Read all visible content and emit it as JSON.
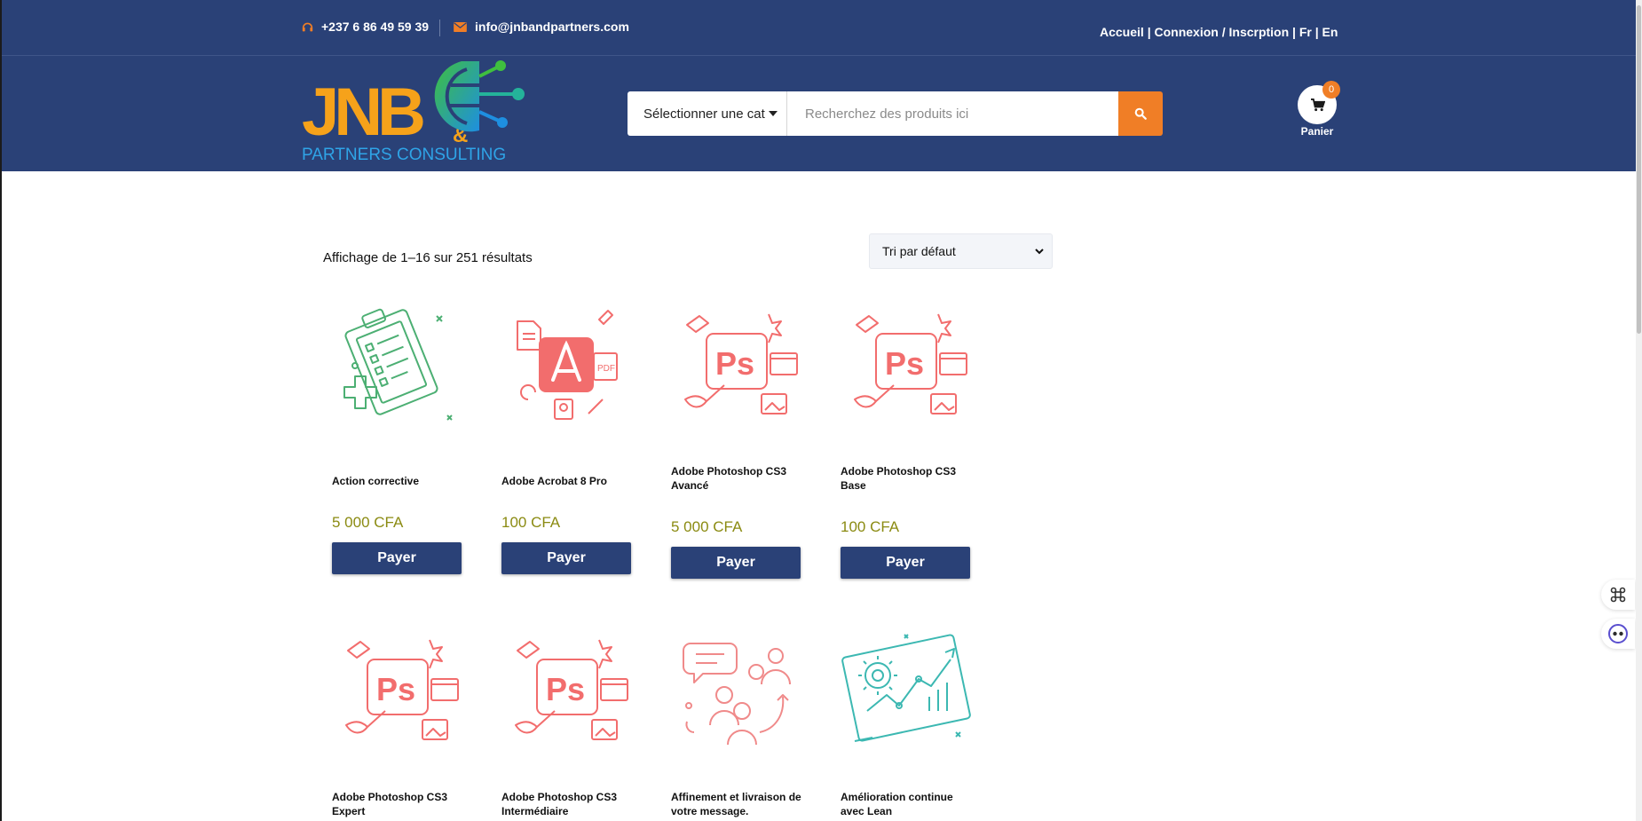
{
  "topbar": {
    "phone": "+237 6 86 49 59 39",
    "email": "info@jnbandpartners.com",
    "links": "Accueil | Connexion / Inscrption | Fr | En"
  },
  "logo": {
    "primary": "JNB",
    "ampersand": "&",
    "secondary": "PARTNERS CONSULTING"
  },
  "search": {
    "category_selected": "Sélectionner une cat",
    "placeholder": "Recherchez des produits ici"
  },
  "cart": {
    "count": "0",
    "label": "Panier"
  },
  "listing": {
    "result_count": "Affichage de 1–16 sur 251 résultats",
    "sort_selected": "Tri par défaut"
  },
  "products": [
    {
      "title": "Action corrective",
      "price": "5 000 CFA",
      "button": "Payer",
      "icon": "clipboard-checklist-icon"
    },
    {
      "title": "Adobe Acrobat 8 Pro",
      "price": "100 CFA",
      "button": "Payer",
      "icon": "acrobat-pdf-icon"
    },
    {
      "title": "Adobe Photoshop CS3 Avancé",
      "price": "5 000 CFA",
      "button": "Payer",
      "icon": "photoshop-icon"
    },
    {
      "title": "Adobe Photoshop CS3 Base",
      "price": "100 CFA",
      "button": "Payer",
      "icon": "photoshop-icon"
    },
    {
      "title": "Adobe Photoshop CS3 Expert",
      "price": "",
      "button": "",
      "icon": "photoshop-icon"
    },
    {
      "title": "Adobe Photoshop CS3 Intermédiaire",
      "price": "",
      "button": "",
      "icon": "photoshop-icon"
    },
    {
      "title": "Affinement et livraison de votre message.",
      "price": "",
      "button": "",
      "icon": "speech-bubbles-people-icon"
    },
    {
      "title": "Amélioration continue avec Lean",
      "price": "",
      "button": "",
      "icon": "gear-growth-chart-icon"
    }
  ],
  "colors": {
    "header_bg": "#2a4177",
    "accent_orange": "#f07e26",
    "price_text": "#8b8b12",
    "button_bg": "#2a4177"
  }
}
